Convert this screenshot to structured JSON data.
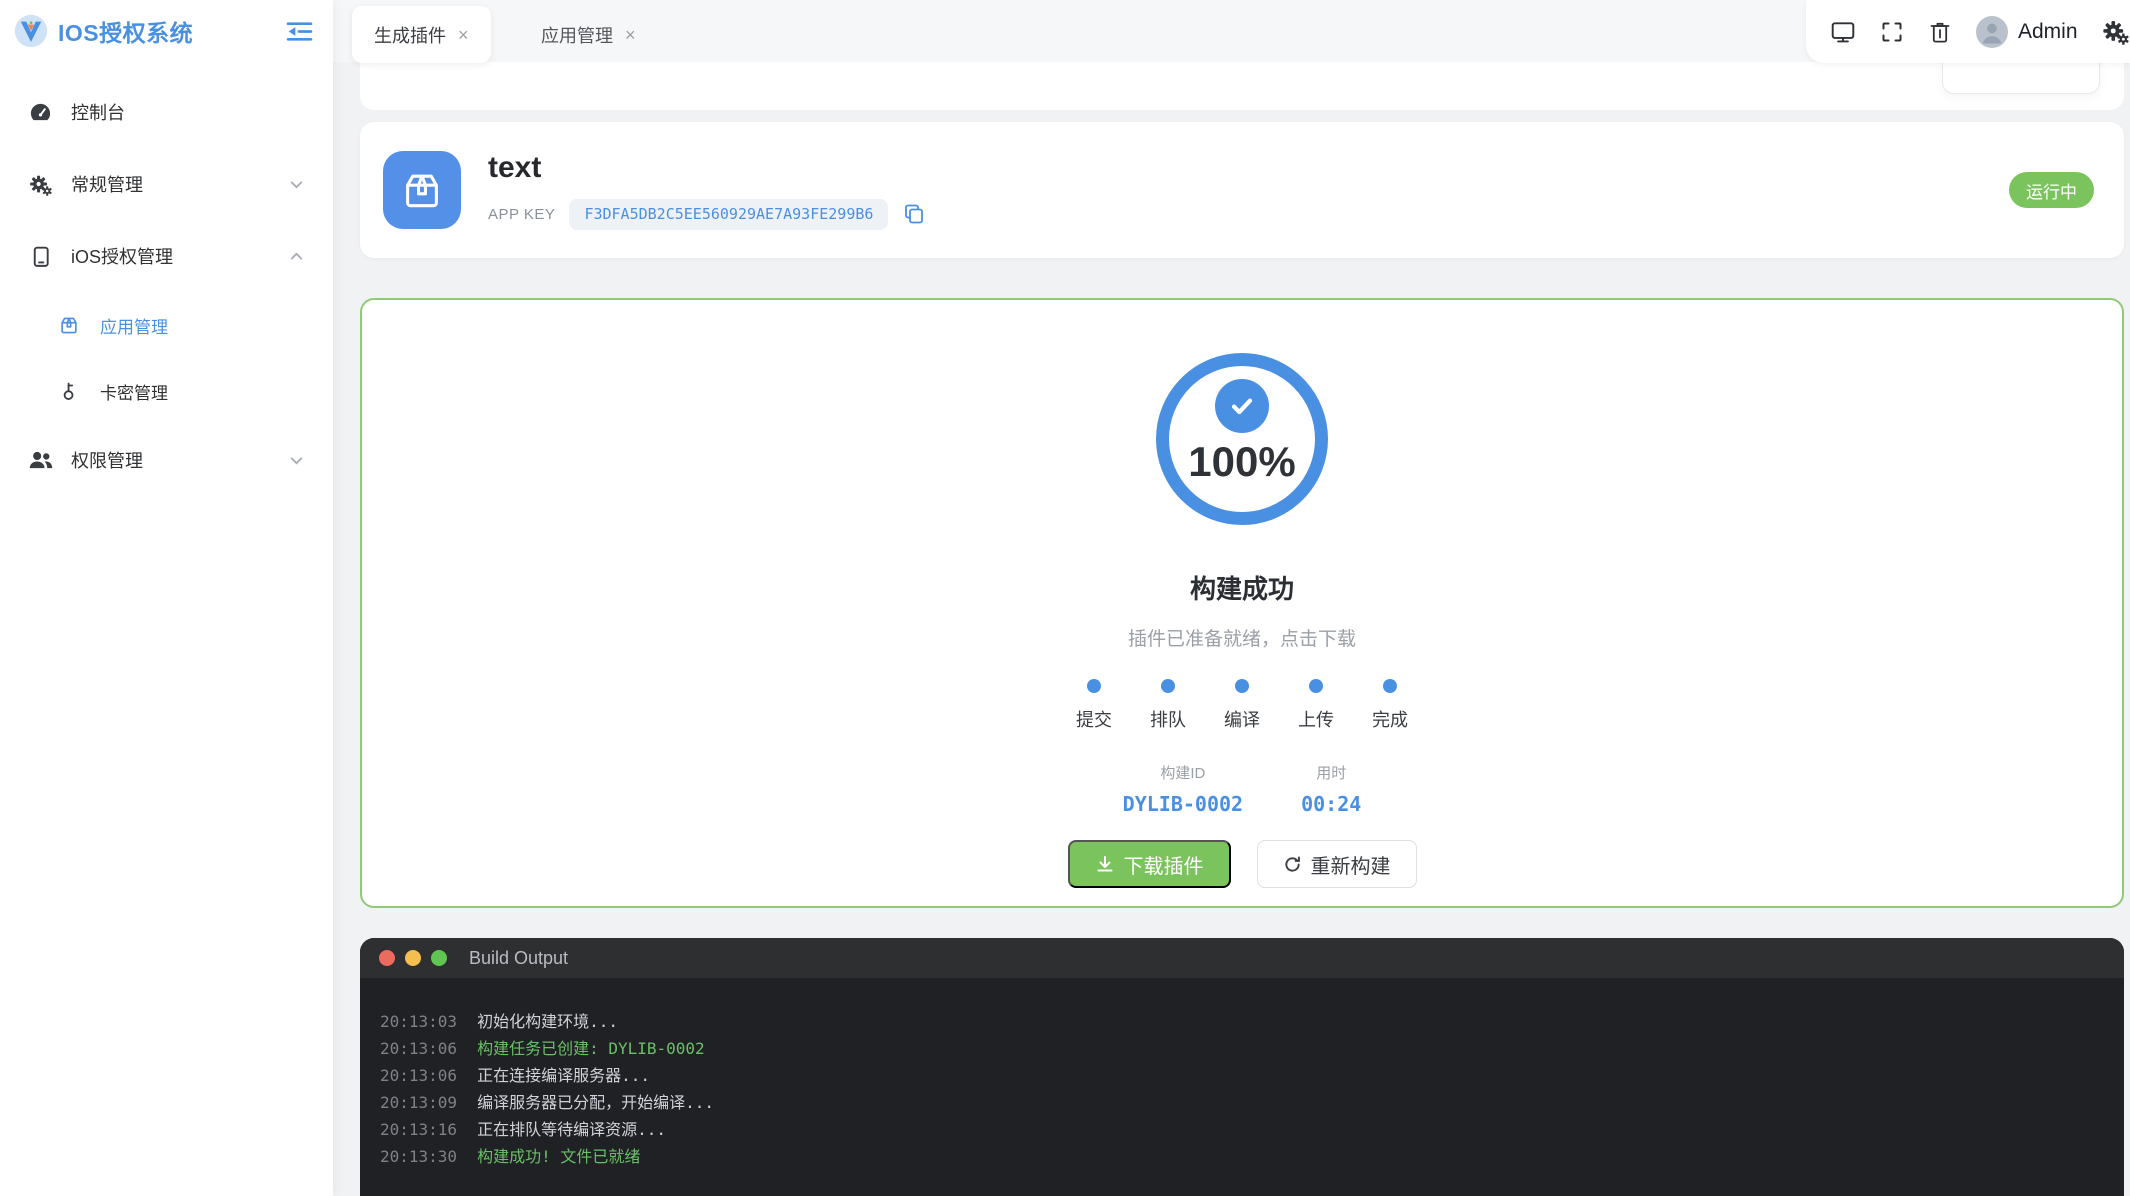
{
  "colors": {
    "accent": "#4a90e2",
    "success": "#7bc35c",
    "successBorder": "#90ca78",
    "terminalGreen": "#6abf69",
    "terminalHeader": "#2e2f31",
    "terminalBody": "#202124",
    "contentBg": "#f1f2f4",
    "topbarBg": "#f6f7f8"
  },
  "ui": {
    "close_glyph": "×"
  },
  "sidebar": {
    "logo_text": "IOS授权系统",
    "items": [
      {
        "label": "控制台",
        "icon": "dashboard"
      },
      {
        "label": "常规管理",
        "icon": "gears",
        "chevron": "down"
      },
      {
        "label": "iOS授权管理",
        "icon": "mobile",
        "chevron": "up"
      },
      {
        "label": "应用管理",
        "icon": "box",
        "active": true
      },
      {
        "label": "卡密管理",
        "icon": "key"
      },
      {
        "label": "权限管理",
        "icon": "users",
        "chevron": "down"
      }
    ]
  },
  "tabs": [
    {
      "label": "生成插件",
      "active": true
    },
    {
      "label": "应用管理",
      "active": false
    }
  ],
  "user": {
    "name": "Admin"
  },
  "app_card": {
    "name": "text",
    "app_key_label": "APP KEY",
    "app_key": "F3DFA5DB2C5EE560929AE7A93FE299B6",
    "status": "运行中"
  },
  "build": {
    "percent": "100%",
    "title": "构建成功",
    "subtitle": "插件已准备就绪，点击下载",
    "steps": [
      "提交",
      "排队",
      "编译",
      "上传",
      "完成"
    ],
    "build_id_label": "构建ID",
    "build_id": "DYLIB-0002",
    "duration_label": "用时",
    "duration": "00:24",
    "download_label": "下载插件",
    "rebuild_label": "重新构建"
  },
  "terminal": {
    "title": "Build Output",
    "lines": [
      {
        "time": "20:13:03",
        "text": "初始化构建环境...",
        "green": false
      },
      {
        "time": "20:13:06",
        "text": "构建任务已创建: DYLIB-0002",
        "green": true
      },
      {
        "time": "20:13:06",
        "text": "正在连接编译服务器...",
        "green": false
      },
      {
        "time": "20:13:09",
        "text": "编译服务器已分配，开始编译...",
        "green": false
      },
      {
        "time": "20:13:16",
        "text": "正在排队等待编译资源...",
        "green": false
      },
      {
        "time": "20:13:30",
        "text": "构建成功! 文件已就绪",
        "green": true
      }
    ]
  }
}
